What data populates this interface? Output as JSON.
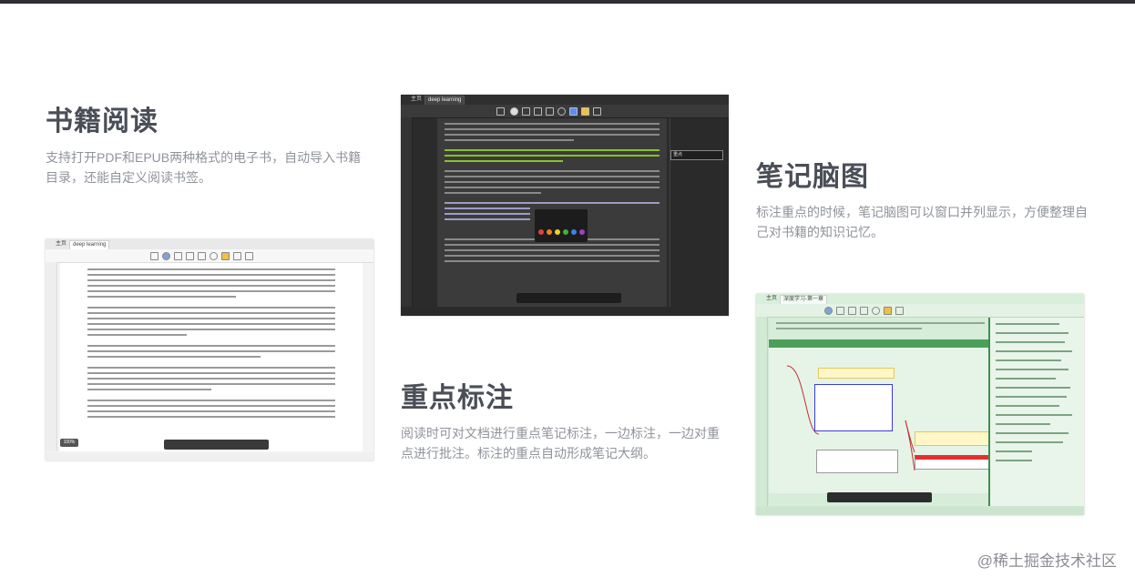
{
  "sections": {
    "reading": {
      "title": "书籍阅读",
      "desc": "支持打开PDF和EPUB两种格式的电子书，自动导入书籍目录，还能自定义阅读书签。"
    },
    "highlight": {
      "title": "重点标注",
      "desc": "阅读时可对文档进行重点笔记标注，一边标注，一边对重点进行批注。标注的重点自动形成笔记大纲。"
    },
    "mindmap": {
      "title": "笔记脑图",
      "desc": "标注重点的时候，笔记脑图可以窗口并列显示，方便整理自己对书籍的知识记忆。"
    }
  },
  "screens": {
    "light": {
      "tab_home": "主页",
      "tab_doc": "deep learning",
      "zoom": "100%"
    },
    "dark": {
      "tab_home": "主页",
      "tab_doc": "deep learning",
      "note_tag": "重点"
    },
    "green": {
      "tab_home": "主页",
      "tab_doc": "深度学习-第一章"
    }
  },
  "watermark": "@稀土掘金技术社区",
  "colors": {
    "heading": "#4a4e57",
    "desc": "#8f939b",
    "highlight_green": "#8ac12a",
    "mindmap_green": "#4aa05a"
  }
}
